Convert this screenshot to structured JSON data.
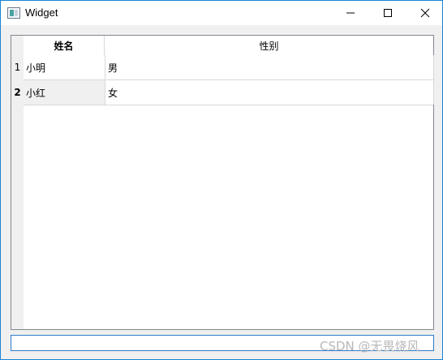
{
  "window": {
    "title": "Widget",
    "icon": "app-window-icon",
    "controls": [
      "minimize-icon",
      "maximize-icon",
      "close-icon"
    ]
  },
  "table": {
    "columns": [
      "姓名",
      "性别"
    ],
    "rows": [
      {
        "index": "1",
        "name": "小明",
        "gender": "男"
      },
      {
        "index": "2",
        "name": "小红",
        "gender": "女"
      }
    ],
    "current_row": "2"
  },
  "watermark": "CSDN @无畏烧风",
  "colors": {
    "border_accent": "#1883d7",
    "header_bg": "#f0f0f0",
    "selection_bg": "#f0f0f0"
  }
}
